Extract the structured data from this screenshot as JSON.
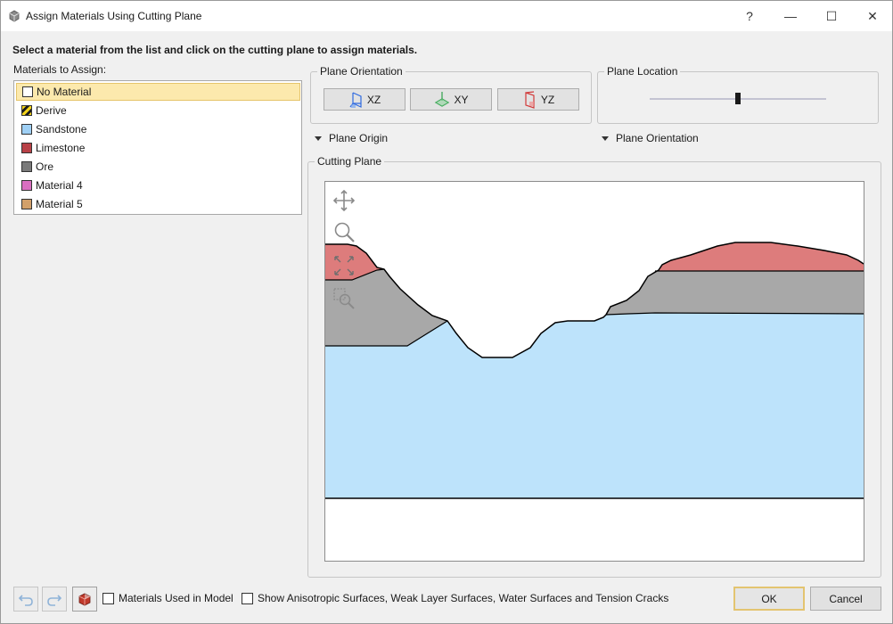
{
  "window": {
    "title": "Assign Materials Using Cutting Plane",
    "help_glyph": "?",
    "minimize_glyph": "—",
    "maximize_glyph": "☐",
    "close_glyph": "✕"
  },
  "instruction": "Select a material from the list and click on the cutting plane to assign materials.",
  "materials": {
    "label": "Materials to Assign:",
    "items": [
      {
        "label": "No Material",
        "color": "#ffffff",
        "selected": true
      },
      {
        "label": "Derive",
        "color": "hatched-yellow-black"
      },
      {
        "label": "Sandstone",
        "color": "#9fd0f5"
      },
      {
        "label": "Limestone",
        "color": "#b84147"
      },
      {
        "label": "Ore",
        "color": "#7a7a7a"
      },
      {
        "label": "Material 4",
        "color": "#d96fc0"
      },
      {
        "label": "Material 5",
        "color": "#d2a06a"
      }
    ]
  },
  "plane_orientation": {
    "title": "Plane Orientation",
    "buttons": [
      {
        "label": "XZ",
        "icon": "xz-plane-icon",
        "color": "#2f6ae0"
      },
      {
        "label": "XY",
        "icon": "xy-plane-icon",
        "color": "#2fa04b"
      },
      {
        "label": "YZ",
        "icon": "yz-plane-icon",
        "color": "#d23a3a"
      }
    ]
  },
  "plane_location": {
    "title": "Plane Location",
    "slider_value": 0.5
  },
  "expanders": {
    "plane_origin": "Plane Origin",
    "plane_orientation": "Plane Orientation"
  },
  "cutting_plane": {
    "title": "Cutting Plane",
    "tools": [
      "pan-icon",
      "zoom-icon",
      "zoom-extents-icon",
      "zoom-window-icon"
    ],
    "layer_colors": {
      "top": "#dd7c7c",
      "middle": "#a8a8a8",
      "bottom": "#bde3fb"
    }
  },
  "bottom": {
    "materials_used_label": "Materials Used in Model",
    "show_surfaces_label": "Show Anisotropic Surfaces, Weak Layer Surfaces, Water Surfaces and Tension Cracks",
    "ok_label": "OK",
    "cancel_label": "Cancel"
  }
}
